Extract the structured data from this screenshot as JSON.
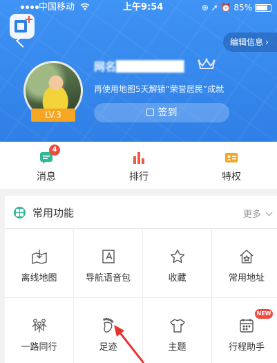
{
  "status_bar": {
    "carrier": "中国移动",
    "wifi_icon": "wifi-icon",
    "time": "上午9:54",
    "indicators": "⊕ ➚ ⏰",
    "battery": "85%"
  },
  "header": {
    "edit_label": "编辑信息",
    "edit_chevron": "›",
    "username": "网名████████",
    "tagline": "再使用地图5天解锁“荣誉居民”成就",
    "level": "LV.3",
    "signin_label": "签到"
  },
  "quickbar": {
    "items": [
      {
        "label": "消息",
        "icon": "message-icon",
        "badge": "4"
      },
      {
        "label": "排行",
        "icon": "ranking-icon"
      },
      {
        "label": "特权",
        "icon": "privilege-icon"
      }
    ]
  },
  "common": {
    "title": "常用功能",
    "more": "更多",
    "items": [
      {
        "label": "离线地图",
        "icon": "offline-map-icon"
      },
      {
        "label": "导航语音包",
        "icon": "voice-pack-icon"
      },
      {
        "label": "收藏",
        "icon": "star-icon"
      },
      {
        "label": "常用地址",
        "icon": "home-icon"
      },
      {
        "label": "一路同行",
        "icon": "group-travel-icon"
      },
      {
        "label": "足迹",
        "icon": "footprint-icon"
      },
      {
        "label": "主题",
        "icon": "theme-shirt-icon"
      },
      {
        "label": "行程助手",
        "icon": "calendar-icon",
        "tag": "NEW"
      }
    ]
  },
  "colors": {
    "header_blue": "#3a8df0",
    "accent_orange": "#f5a623",
    "badge_red": "#f04a3e",
    "message_green": "#2fb898",
    "ranking_red": "#ef5a45",
    "privilege_orange": "#f5a623",
    "arrow_red": "#e5322d"
  }
}
